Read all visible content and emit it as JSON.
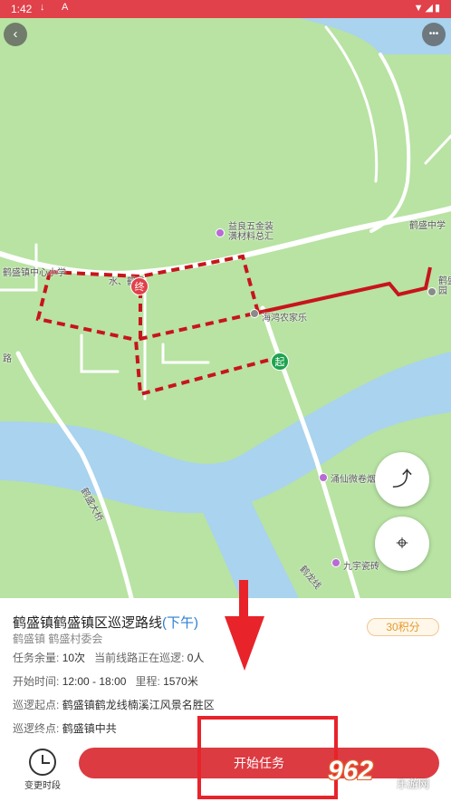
{
  "status_bar": {
    "time": "1:42",
    "left_icons": "↓ A",
    "right_icons": "▼◢▮"
  },
  "map": {
    "back_icon": "‹",
    "more_icon": "•••",
    "labels": {
      "school": "鹤盛镇中心小学",
      "near_end": "水、鹤盛",
      "hardware": "益良五金装\n潢材料总汇",
      "heming": "鹤盛中学",
      "farm": "海鸿农家乐",
      "road_left": "路",
      "bridge": "鹤盛大桥",
      "yunxian": "涌仙微卷烟",
      "jiuyu": "九宇瓷砖",
      "helong_line": "鹤龙线",
      "right_poi": "鹤盛\n园"
    },
    "pin_end": "终",
    "pin_start": "起",
    "route_btn_icon": "route-icon",
    "locate_btn_icon": "locate-icon"
  },
  "task": {
    "title": "鹤盛镇鹤盛镇区巡逻路线",
    "period": "(下午)",
    "org": "鹤盛镇 鹤盛村委会",
    "points": "30积分",
    "remaining_label": "任务余量:",
    "remaining_value": "10次",
    "current_label": "当前线路正在巡逻:",
    "current_value": "0人",
    "time_label": "开始时间:",
    "time_value": "12:00 - 18:00",
    "distance_label": "里程:",
    "distance_value": "1570米",
    "start_label": "巡逻起点:",
    "start_value": "鹤盛镇鹤龙线楠溪江风景名胜区",
    "end_label": "巡逻终点:",
    "end_value": "鹤盛镇中共"
  },
  "actions": {
    "change_time": "变更时段",
    "start_task": "开始任务"
  },
  "watermark": {
    "logo": "962",
    "site": "乐游网"
  },
  "colors": {
    "accent": "#dc3b42",
    "map_green": "#b8e3a3",
    "water": "#a9d3ee",
    "route": "#c8141c"
  }
}
